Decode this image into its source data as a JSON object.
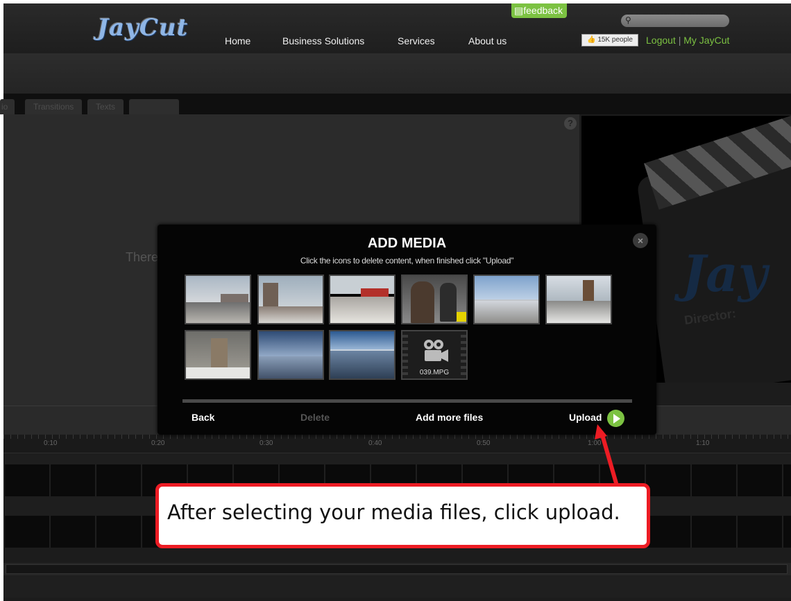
{
  "app": {
    "logo_text": "JayCut"
  },
  "header": {
    "feedback_label": "feedback",
    "nav": [
      "Home",
      "Business Solutions",
      "Services",
      "About us"
    ],
    "search": {
      "placeholder": ""
    },
    "likes_label": "15K people",
    "logout_label": "Logout",
    "separator": "|",
    "my_jaycut_label": "My JayCut"
  },
  "editor": {
    "tabs": [
      "io",
      "Transitions",
      "Texts",
      ""
    ],
    "empty_text": "There",
    "help_label": "?",
    "preview": {
      "logo_text": "Jay",
      "director_label": "Director:"
    },
    "timeline_ticks": [
      "0:10",
      "0:20",
      "0:30",
      "0:40",
      "0:50",
      "1:00",
      "1:10"
    ]
  },
  "modal": {
    "title": "ADD MEDIA",
    "subtitle": "Click the icons to delete content, when finished click \"Upload\"",
    "close_label": "×",
    "video_file_name": "039.MPG",
    "buttons": {
      "back": "Back",
      "delete": "Delete",
      "add_more": "Add more files",
      "upload": "Upload"
    }
  },
  "annotation": {
    "text": "After selecting your media files, click upload.",
    "color": "#ed1c24"
  },
  "colors": {
    "accent_green": "#7cc242",
    "logo_blue": "#8fb6e6"
  }
}
